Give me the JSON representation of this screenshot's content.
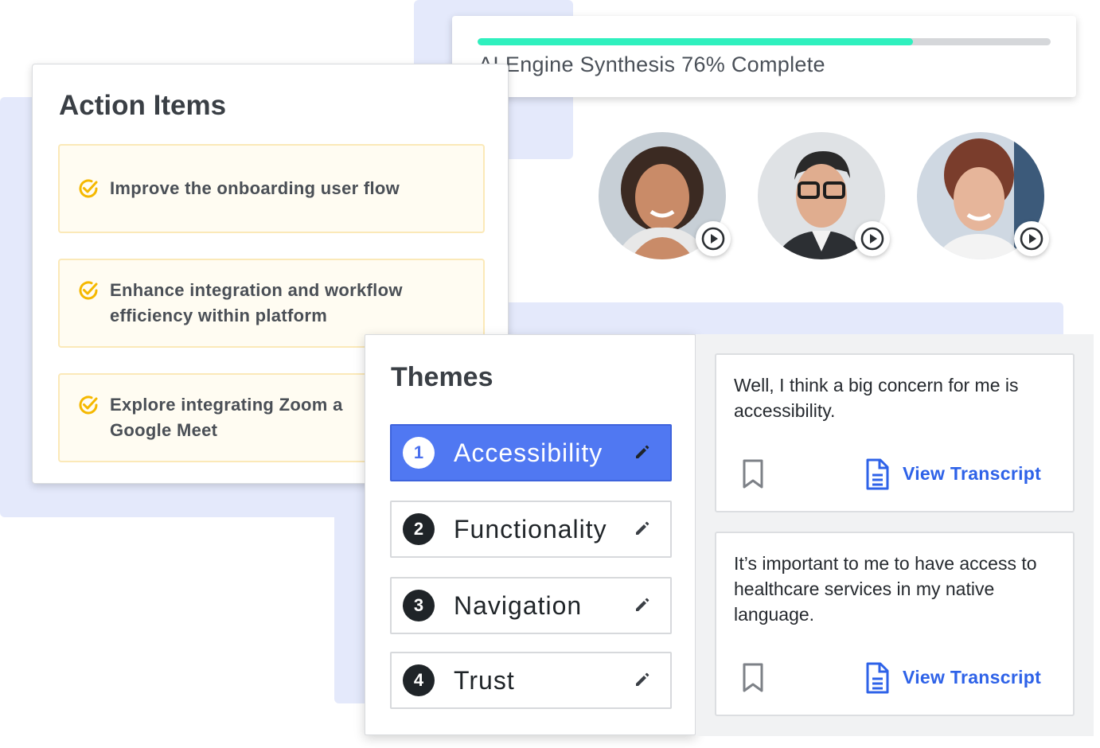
{
  "progress": {
    "label": "AI Engine Synthesis 76% Complete",
    "percent": 76,
    "fill_color": "#2ff0be"
  },
  "participants": [
    {
      "name": "participant-1",
      "icon": "play-icon"
    },
    {
      "name": "participant-2",
      "icon": "play-icon"
    },
    {
      "name": "participant-3",
      "icon": "play-icon"
    }
  ],
  "action_items": {
    "title": "Action Items",
    "items": [
      {
        "icon": "check-circle-icon",
        "line1": "Improve the onboarding user flow",
        "line2": ""
      },
      {
        "icon": "check-circle-icon",
        "line1": "Enhance integration and workflow",
        "line2": "efficiency within platform"
      },
      {
        "icon": "check-circle-icon",
        "line1": "Explore integrating Zoom a",
        "line2": "Google Meet"
      }
    ]
  },
  "themes": {
    "title": "Themes",
    "items": [
      {
        "number": "1",
        "label": "Accessibility",
        "active": true
      },
      {
        "number": "2",
        "label": "Functionality",
        "active": false
      },
      {
        "number": "3",
        "label": "Navigation",
        "active": false
      },
      {
        "number": "4",
        "label": "Trust",
        "active": false
      }
    ]
  },
  "quotes": [
    {
      "text": "Well, I think a big concern for me is accessibility.",
      "link": "View Transcript"
    },
    {
      "text": "It’s important to me to have access to healthcare services in my native language.",
      "link": "View Transcript"
    }
  ],
  "colors": {
    "accent_blue": "#5078f2",
    "link_blue": "#2e62e8",
    "check_yellow": "#f5b800",
    "background_block": "#e4e9fb"
  }
}
